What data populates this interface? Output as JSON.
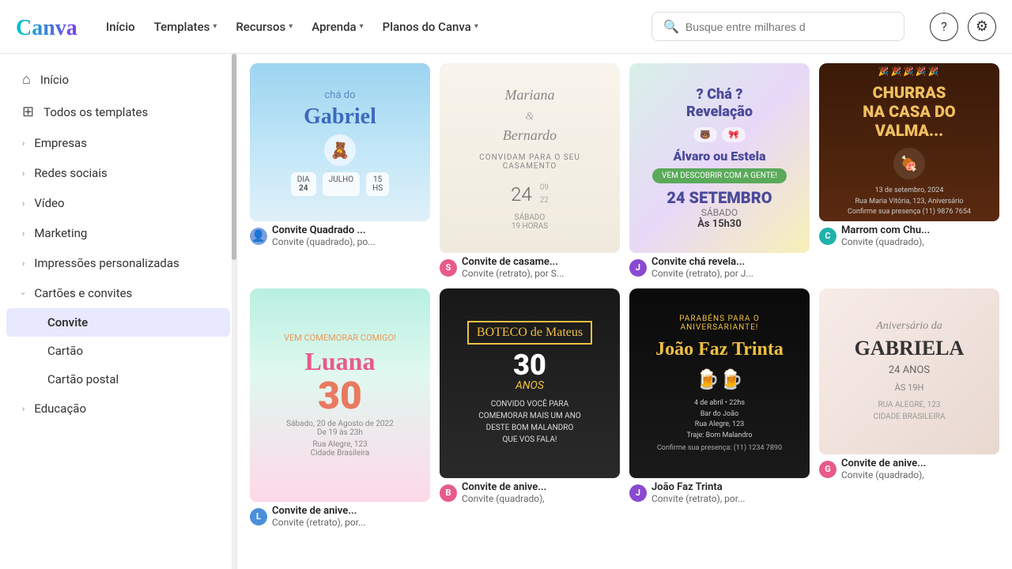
{
  "header": {
    "logo_alt": "Canva",
    "nav": [
      {
        "label": "Início",
        "has_dropdown": false
      },
      {
        "label": "Templates",
        "has_dropdown": true
      },
      {
        "label": "Recursos",
        "has_dropdown": true
      },
      {
        "label": "Aprenda",
        "has_dropdown": true
      },
      {
        "label": "Planos do Canva",
        "has_dropdown": true
      }
    ],
    "search_placeholder": "Busque entre milhares d",
    "help_icon": "?",
    "settings_icon": "⚙"
  },
  "sidebar": {
    "items": [
      {
        "id": "inicio",
        "label": "Início",
        "icon": "home",
        "type": "main",
        "expandable": false
      },
      {
        "id": "todos-templates",
        "label": "Todos os templates",
        "icon": "grid",
        "type": "main",
        "expandable": false
      },
      {
        "id": "empresas",
        "label": "Empresas",
        "icon": null,
        "type": "main",
        "expandable": true,
        "expanded": false
      },
      {
        "id": "redes-sociais",
        "label": "Redes sociais",
        "icon": null,
        "type": "main",
        "expandable": true,
        "expanded": false
      },
      {
        "id": "video",
        "label": "Vídeo",
        "icon": null,
        "type": "main",
        "expandable": true,
        "expanded": false
      },
      {
        "id": "marketing",
        "label": "Marketing",
        "icon": null,
        "type": "main",
        "expandable": true,
        "expanded": false
      },
      {
        "id": "impressoes",
        "label": "Impressões personalizadas",
        "icon": null,
        "type": "main",
        "expandable": true,
        "expanded": false
      },
      {
        "id": "cartoes-convites",
        "label": "Cartões e convites",
        "icon": null,
        "type": "main",
        "expandable": true,
        "expanded": true
      },
      {
        "id": "convite",
        "label": "Convite",
        "type": "sub",
        "active": true
      },
      {
        "id": "cartao",
        "label": "Cartão",
        "type": "sub"
      },
      {
        "id": "cartao-postal",
        "label": "Cartão postal",
        "type": "sub"
      },
      {
        "id": "educacao",
        "label": "Educação",
        "icon": null,
        "type": "main",
        "expandable": true,
        "expanded": false
      }
    ]
  },
  "templates": [
    {
      "id": "gabriel",
      "title": "Convite Quadrado ...",
      "subtitle": "Convite (quadrado), po...",
      "avatar_type": "person",
      "avatar_initials": "👤",
      "row": 1,
      "col": 1
    },
    {
      "id": "casamento",
      "title": "Convite de casame...",
      "subtitle": "Convite (retrato), por S...",
      "avatar_type": "pink",
      "avatar_initials": "S",
      "row": 1,
      "col": 2
    },
    {
      "id": "revelacao",
      "title": "Convite chá revela...",
      "subtitle": "Convite (retrato), por J...",
      "avatar_type": "purple",
      "avatar_initials": "J",
      "row": 1,
      "col": 3
    },
    {
      "id": "churrasco",
      "title": "Marrom com Chu...",
      "subtitle": "Convite (quadrado),",
      "avatar_type": "cyan",
      "avatar_initials": "C",
      "row": 1,
      "col": 4
    },
    {
      "id": "luana",
      "title": "Convite de anive...",
      "subtitle": "Convite (retrato), por...",
      "avatar_type": "blue",
      "avatar_initials": "L",
      "row": 2,
      "col": 1
    },
    {
      "id": "boteco",
      "title": "Convite de anive...",
      "subtitle": "Convite (quadrado),",
      "avatar_type": "pink",
      "avatar_initials": "B",
      "row": 2,
      "col": 2
    },
    {
      "id": "joao",
      "title": "João Faz Trinta",
      "subtitle": "Convite (retrato), por...",
      "avatar_type": "purple",
      "avatar_initials": "J",
      "row": 2,
      "col": 3
    },
    {
      "id": "gabriela",
      "title": "Convite de anive...",
      "subtitle": "Convite (quadrado),",
      "avatar_type": "pink",
      "avatar_initials": "G",
      "row": 2,
      "col": 4
    }
  ],
  "colors": {
    "accent": "#7c3aed",
    "active_sidebar_bg": "#f0f0f0",
    "active_sub_bg": "#ede9fe",
    "logo_cyan": "#00c4cc",
    "logo_purple": "#7c3aed"
  }
}
